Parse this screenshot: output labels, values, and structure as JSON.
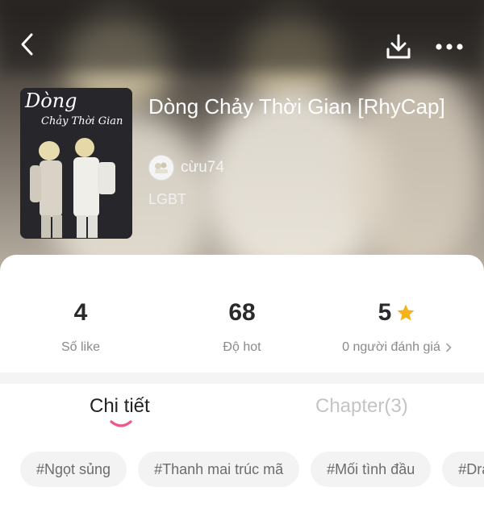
{
  "header": {
    "back_icon": "chevron-left-icon",
    "download_icon": "download-icon",
    "more_icon": "more-horizontal-icon"
  },
  "cover": {
    "title_line1": "Dòng",
    "title_line2": "Chảy Thời Gian"
  },
  "story": {
    "title": "Dòng Chảy Thời Gian [RhyCap]",
    "author": "cừu74",
    "category": "LGBT"
  },
  "stats": [
    {
      "value": "4",
      "label": "Số like"
    },
    {
      "value": "68",
      "label": "Độ hot"
    },
    {
      "value": "5",
      "label": "0 người đánh giá"
    }
  ],
  "tabs": {
    "detail": "Chi tiết",
    "chapters": "Chapter(3)"
  },
  "tags": [
    "#Ngọt sủng",
    "#Thanh mai trúc mã",
    "#Mối tình đầu",
    "#Dra"
  ],
  "colors": {
    "accent": "#f0568a",
    "star": "#f6b21a"
  }
}
